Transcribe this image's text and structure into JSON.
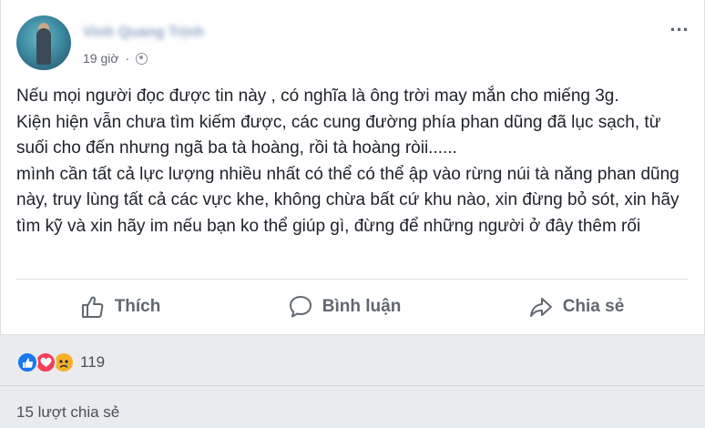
{
  "post": {
    "author_name": "Vinh Quang Trịnh",
    "time": "19 giờ",
    "separator": "·",
    "paragraphs": [
      "Nếu mọi người đọc được tin này , có nghĩa là ông trời may mắn cho miếng 3g.\nKiện hiện vẫn chưa tìm kiếm được, các cung đường phía phan dũng đã lục sạch, từ suối cho đến nhưng ngã ba tà hoàng, rồi tà hoàng ròii......",
      "mình cần tất cả lực lượng nhiều nhất có thể có thể ập vào rừng núi tà năng phan dũng này, truy lùng tất cả các vực khe, không chừa bất cứ khu nào, xin đừng bỏ sót, xin hãy tìm kỹ và xin hãy im nếu bạn ko thể giúp gì, đừng để những người ở đây thêm rối"
    ]
  },
  "actions": {
    "like_label": "Thích",
    "comment_label": "Bình luận",
    "share_label": "Chia sẻ"
  },
  "reactions": {
    "icons": [
      "like-icon",
      "love-icon",
      "sad-icon"
    ],
    "count": "119"
  },
  "shares": {
    "label": "15 lượt chia sẻ"
  },
  "colors": {
    "link_blue": "#365899",
    "like_blue": "#1877f2",
    "love_red": "#f33e58",
    "sad_yellow": "#f7b125",
    "muted_gray": "#606770"
  }
}
